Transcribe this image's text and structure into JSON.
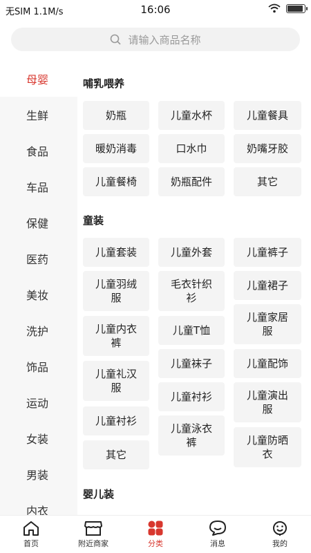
{
  "status": {
    "carrier": "无SIM 1.1M/s",
    "time": "16:06",
    "battery_level": 0.9
  },
  "search": {
    "placeholder": "请输入商品名称"
  },
  "sidebar": {
    "items": [
      {
        "label": "母婴"
      },
      {
        "label": "生鲜"
      },
      {
        "label": "食品"
      },
      {
        "label": "车品"
      },
      {
        "label": "保健"
      },
      {
        "label": "医药"
      },
      {
        "label": "美妆"
      },
      {
        "label": "洗护"
      },
      {
        "label": "饰品"
      },
      {
        "label": "运动"
      },
      {
        "label": "女装"
      },
      {
        "label": "男装"
      },
      {
        "label": "内衣"
      }
    ]
  },
  "sections": [
    {
      "title": "哺乳喂养",
      "items": [
        "奶瓶",
        "儿童水杯",
        "儿童餐具",
        "暖奶消毒",
        "口水巾",
        "奶嘴牙胶",
        "儿童餐椅",
        "奶瓶配件",
        "其它"
      ]
    },
    {
      "title": "童装",
      "items": [
        "儿童套装",
        "儿童外套",
        "儿童裤子",
        "儿童羽绒服",
        "毛衣针织衫",
        "儿童裙子",
        "儿童内衣裤",
        "儿童T恤",
        "儿童家居服",
        "儿童礼汉服",
        "儿童袜子",
        "儿童配饰",
        "儿童衬衫",
        "儿童演出服",
        "儿童校服",
        "儿童泳衣裤",
        "儿童防晒衣",
        "其它"
      ]
    },
    {
      "title": "婴儿装",
      "items": []
    }
  ],
  "tabbar": {
    "tabs": [
      {
        "label": "首页"
      },
      {
        "label": "附近商家"
      },
      {
        "label": "分类"
      },
      {
        "label": "消息"
      },
      {
        "label": "我的"
      }
    ]
  },
  "colors": {
    "accent": "#d8372e",
    "chip_bg": "#f4f4f4",
    "sidebar_bg": "#f7f7f7"
  }
}
